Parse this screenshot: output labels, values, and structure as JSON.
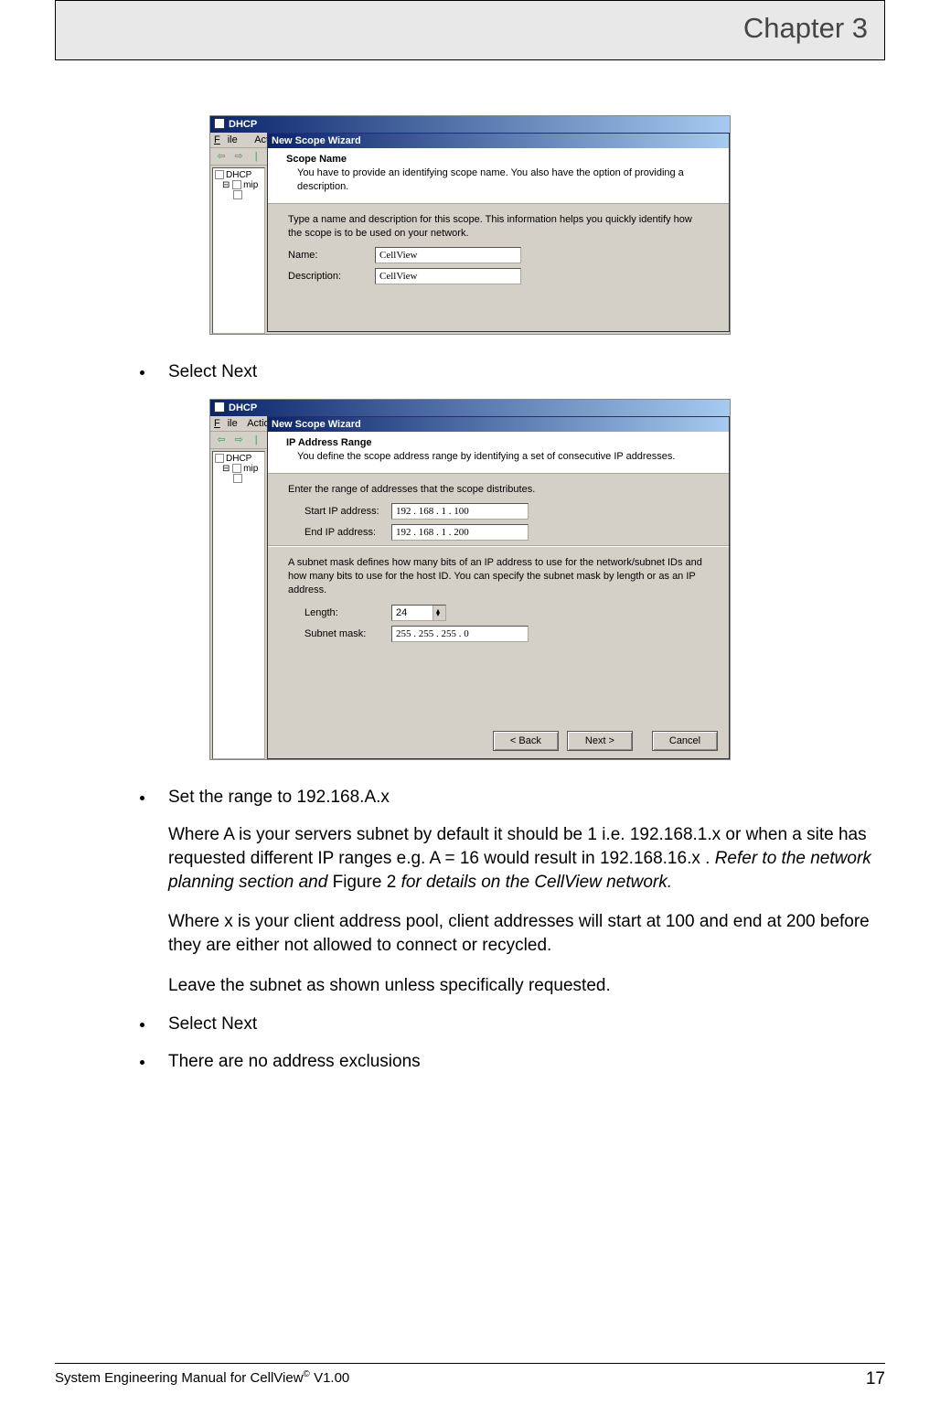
{
  "header": {
    "chapter": "Chapter 3"
  },
  "bullets": {
    "b1": "Select Next",
    "b2": "Set the range to 192.168.A.x",
    "b3": "Select Next",
    "b4": "There are no address exclusions"
  },
  "para": {
    "p1a": "Where A is your servers subnet by default it should be 1 i.e. 192.168.1.x or when a site has requested different IP ranges e.g. A = 16 would result in 192.168.16.x . ",
    "p1b": "Refer to the network planning section and ",
    "p1c": "Figure 2",
    "p1d": " for details on the CellView network.",
    "p2": "Where x is your client address pool, client addresses will start at 100 and end at 200 before they are either not allowed to connect or recycled.",
    "p3": "Leave the subnet as shown unless specifically requested."
  },
  "dhcp": {
    "appTitle": "DHCP",
    "menu": {
      "file": "File",
      "action": "Actio"
    },
    "nav": {
      "back": "⇦",
      "fwd": "⇨"
    },
    "tree": {
      "root": "DHCP",
      "node1": "mip",
      "node2": ""
    },
    "wizardTitle": "New Scope Wizard",
    "scopeName": {
      "title": "Scope Name",
      "sub": "You have to provide an identifying scope name. You also have the option of providing a description.",
      "instr": "Type a name and description for this scope. This information helps you quickly identify how the scope is to be used on your network.",
      "nameLabel": "Name:",
      "descLabel": "Description:",
      "nameVal": "CellView",
      "descVal": "CellView"
    },
    "ipRange": {
      "title": "IP Address Range",
      "sub": "You define the scope address range by identifying a set of consecutive IP addresses.",
      "instr1": "Enter the range of addresses that the scope distributes.",
      "startLabel": "Start IP address:",
      "endLabel": "End IP address:",
      "startVal": "192 . 168 .    1    . 100",
      "endVal": "192 . 168 .    1    . 200",
      "subnetInstr": "A subnet mask defines how many bits of an IP address to use for the network/subnet IDs and how many bits to use for the host ID. You can specify the subnet mask by length or as an IP address.",
      "lenLabel": "Length:",
      "lenVal": "24",
      "maskLabel": "Subnet mask:",
      "maskVal": "255 . 255 . 255 .    0"
    },
    "buttons": {
      "back": "< Back",
      "next": "Next >",
      "cancel": "Cancel"
    }
  },
  "footer": {
    "left1": "System Engineering Manual for CellView",
    "left2": " V1.00",
    "page": "17"
  }
}
